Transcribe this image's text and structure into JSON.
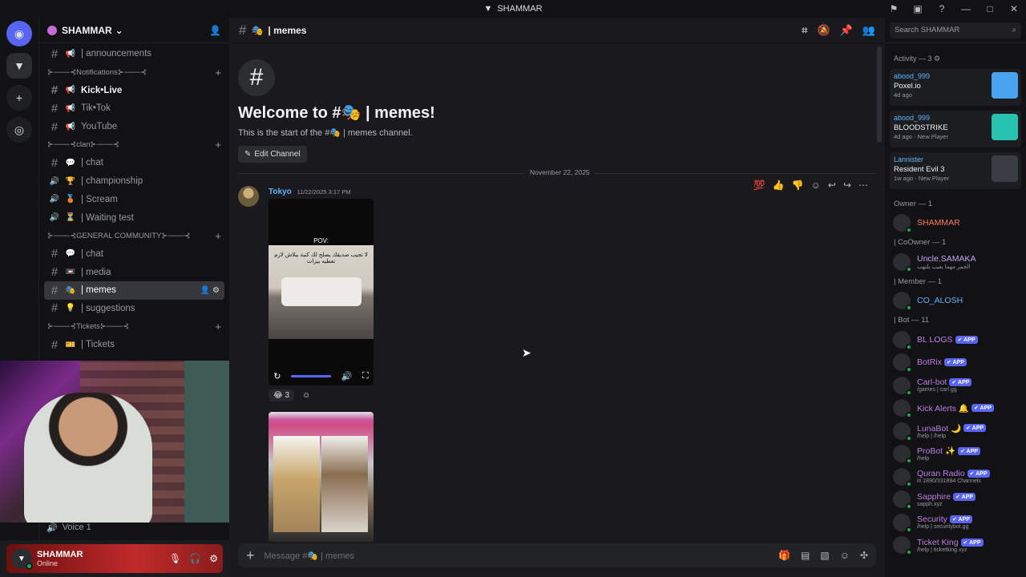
{
  "window": {
    "title": "SHAMMAR"
  },
  "server": {
    "name": "SHAMMAR"
  },
  "channels": [
    {
      "type": "channel",
      "emoji": "📢",
      "label": "| announcements",
      "style": "normal"
    },
    {
      "type": "category",
      "label": "⊱───⊰Notifications⊱───⊰"
    },
    {
      "type": "channel",
      "emoji": "📢",
      "label": "Kick•Live",
      "style": "bright"
    },
    {
      "type": "channel",
      "emoji": "📢",
      "label": "Tik•Tok",
      "style": "normal"
    },
    {
      "type": "channel",
      "emoji": "📢",
      "label": "YouTube",
      "style": "normal"
    },
    {
      "type": "category",
      "label": "⊱───⊰clan⊱───⊰"
    },
    {
      "type": "channel",
      "emoji": "💬",
      "label": "| chat",
      "style": "normal"
    },
    {
      "type": "voice",
      "emoji": "🏆",
      "label": "| championship",
      "style": "normal"
    },
    {
      "type": "voice",
      "emoji": "🥉",
      "label": "| Scream",
      "style": "normal"
    },
    {
      "type": "voice",
      "emoji": "⏳",
      "label": "| Waiting test",
      "style": "normal"
    },
    {
      "type": "category",
      "label": "⊱───⊰GENERAL COMMUNITY⊱───⊰"
    },
    {
      "type": "channel",
      "emoji": "💬",
      "label": "| chat",
      "style": "normal"
    },
    {
      "type": "channel",
      "emoji": "📼",
      "label": "| media",
      "style": "normal"
    },
    {
      "type": "channel",
      "emoji": "🎭",
      "label": "| memes",
      "style": "active"
    },
    {
      "type": "channel",
      "emoji": "💡",
      "label": "| suggestions",
      "style": "normal"
    },
    {
      "type": "category",
      "label": "⊱───⊰Tickets⊱───⊰"
    },
    {
      "type": "channel",
      "emoji": "🎫",
      "label": "| Tickets",
      "style": "normal"
    }
  ],
  "voice_channel": {
    "label": "Voice 1"
  },
  "user_panel": {
    "name": "SHAMMAR",
    "status": "Online"
  },
  "chat": {
    "channel_name": "| memes",
    "channel_emoji": "🎭",
    "welcome_title": "Welcome to #🎭 | memes!",
    "welcome_sub": "This is the start of the #🎭 | memes channel.",
    "edit_channel": "Edit Channel",
    "date_divider": "November 22, 2025",
    "message": {
      "author": "Tokyo",
      "timestamp": "11/22/2025 3:17 PM",
      "video_caption": "POV:",
      "video_overlay": "لا تجيب صديقك يصلح لك كنبة ببلاش لازم تعطيه بيزات",
      "reaction_emoji": "😂",
      "reaction_count": "3"
    },
    "composer_placeholder": "Message #🎭 | memes"
  },
  "members_panel": {
    "search_placeholder": "Search SHAMMAR",
    "activity_header": "Activity — 3",
    "activities": [
      {
        "user": "abood_999",
        "game": "Poxel.io",
        "sub": "4d ago",
        "color": "#4aa3f0"
      },
      {
        "user": "abood_999",
        "game": "BLOODSTRIKE",
        "sub": "4d ago · New Player",
        "color": "#28c2b0"
      },
      {
        "user": "Lannister",
        "game": "Resident Evil 3",
        "sub": "1w ago · New Player",
        "color": "#3a3d45"
      }
    ],
    "groups": [
      {
        "header": "Owner — 1",
        "members": [
          {
            "name": "SHAMMAR",
            "sub": "",
            "app": false,
            "color": "#ff7b5a"
          }
        ]
      },
      {
        "header": "| CoOwner — 1",
        "members": [
          {
            "name": "Uncle.SAMAKA",
            "sub": "الجمر مهما يعيب يلتهب",
            "app": false,
            "color": "#c8a0ff"
          }
        ]
      },
      {
        "header": "| Member — 1",
        "members": [
          {
            "name": "CO_ALOSH",
            "sub": "",
            "app": false,
            "color": "#5fb4ff"
          }
        ]
      },
      {
        "header": "| Bot — 11",
        "members": [
          {
            "name": "BL LOGS",
            "sub": "",
            "app": true,
            "color": "#c07de8"
          },
          {
            "name": "BotRix",
            "sub": "",
            "app": true,
            "color": "#c07de8"
          },
          {
            "name": "Carl-bot",
            "sub": "/games | carl.gg",
            "app": true,
            "color": "#c07de8"
          },
          {
            "name": "Kick Alerts 🔔",
            "sub": "",
            "app": true,
            "color": "#c07de8"
          },
          {
            "name": "LunaBot 🌙",
            "sub": "/help | /help",
            "app": true,
            "color": "#c07de8"
          },
          {
            "name": "ProBot ✨",
            "sub": "/help",
            "app": true,
            "color": "#c07de8"
          },
          {
            "name": "Quran Radio",
            "sub": "in 2890/331894 Channels",
            "app": true,
            "color": "#c07de8"
          },
          {
            "name": "Sapphire",
            "sub": "sapph.xyz",
            "app": true,
            "color": "#c07de8"
          },
          {
            "name": "Security",
            "sub": "/help | securitybot.gg",
            "app": true,
            "color": "#c07de8"
          },
          {
            "name": "Ticket King",
            "sub": "/help | ticketking.xyz",
            "app": true,
            "color": "#c07de8"
          }
        ]
      }
    ],
    "app_tag": "✔ APP"
  }
}
